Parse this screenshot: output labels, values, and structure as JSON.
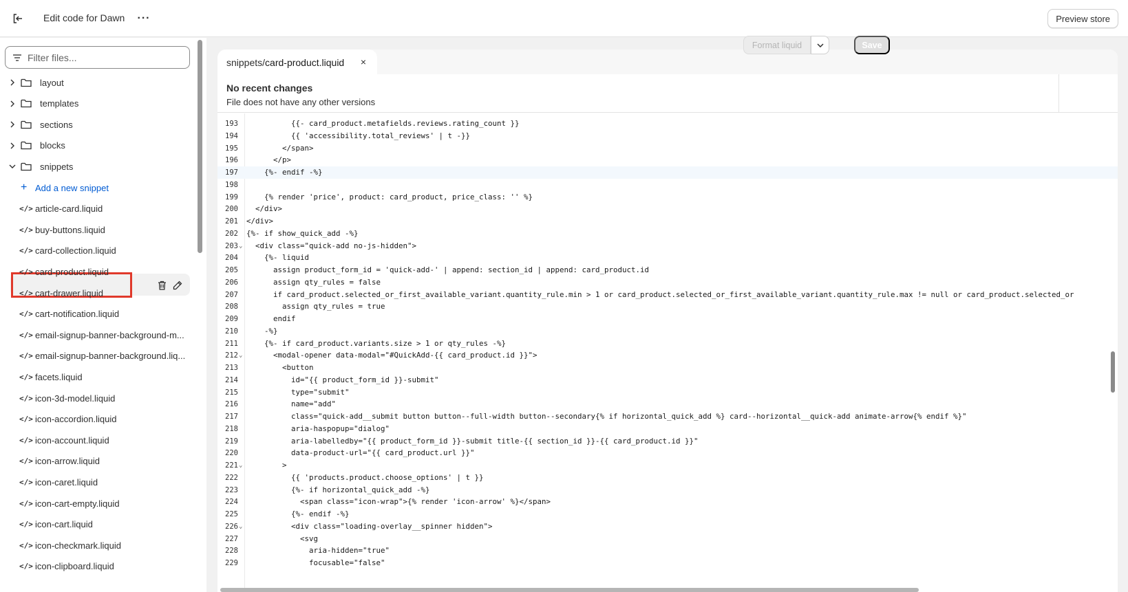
{
  "topbar": {
    "title": "Edit code for Dawn",
    "more": "···",
    "preview_label": "Preview store"
  },
  "sidebar": {
    "filter_placeholder": "Filter files...",
    "folders": [
      {
        "label": "layout",
        "expanded": false
      },
      {
        "label": "templates",
        "expanded": false
      },
      {
        "label": "sections",
        "expanded": false
      },
      {
        "label": "blocks",
        "expanded": false
      },
      {
        "label": "snippets",
        "expanded": true
      }
    ],
    "add_snippet_label": "Add a new snippet",
    "files": [
      "article-card.liquid",
      "buy-buttons.liquid",
      "card-collection.liquid",
      "card-product.liquid",
      "cart-drawer.liquid",
      "cart-notification.liquid",
      "email-signup-banner-background-m...",
      "email-signup-banner-background.liq...",
      "facets.liquid",
      "icon-3d-model.liquid",
      "icon-accordion.liquid",
      "icon-account.liquid",
      "icon-arrow.liquid",
      "icon-caret.liquid",
      "icon-cart-empty.liquid",
      "icon-cart.liquid",
      "icon-checkmark.liquid",
      "icon-clipboard.liquid"
    ],
    "selected_file": "card-product.liquid"
  },
  "editor": {
    "tab": {
      "dir": "snippets/",
      "name": "card-product.liquid",
      "close": "×"
    },
    "info_title": "No recent changes",
    "info_sub": "File does not have any other versions",
    "format_label": "Format liquid",
    "save_label": "Save",
    "current_line": 197,
    "lines": [
      {
        "n": 193,
        "text": "          {{- card_product.metafields.reviews.rating_count }}"
      },
      {
        "n": 194,
        "text": "          {{ 'accessibility.total_reviews' | t -}}"
      },
      {
        "n": 195,
        "text": "        </span>"
      },
      {
        "n": 196,
        "text": "      </p>"
      },
      {
        "n": 197,
        "text": "    {%- endif -%}"
      },
      {
        "n": 198,
        "text": ""
      },
      {
        "n": 199,
        "text": "    {% render 'price', product: card_product, price_class: '' %}"
      },
      {
        "n": 200,
        "text": "  </div>"
      },
      {
        "n": 201,
        "text": "</div>"
      },
      {
        "n": 202,
        "text": "{%- if show_quick_add -%}"
      },
      {
        "n": 203,
        "text": "  <div class=\"quick-add no-js-hidden\">",
        "fold": true
      },
      {
        "n": 204,
        "text": "    {%- liquid"
      },
      {
        "n": 205,
        "text": "      assign product_form_id = 'quick-add-' | append: section_id | append: card_product.id"
      },
      {
        "n": 206,
        "text": "      assign qty_rules = false"
      },
      {
        "n": 207,
        "text": "      if card_product.selected_or_first_available_variant.quantity_rule.min > 1 or card_product.selected_or_first_available_variant.quantity_rule.max != null or card_product.selected_or"
      },
      {
        "n": 208,
        "text": "        assign qty_rules = true"
      },
      {
        "n": 209,
        "text": "      endif"
      },
      {
        "n": 210,
        "text": "    -%}"
      },
      {
        "n": 211,
        "text": "    {%- if card_product.variants.size > 1 or qty_rules -%}"
      },
      {
        "n": 212,
        "text": "      <modal-opener data-modal=\"#QuickAdd-{{ card_product.id }}\">",
        "fold": true
      },
      {
        "n": 213,
        "text": "        <button"
      },
      {
        "n": 214,
        "text": "          id=\"{{ product_form_id }}-submit\""
      },
      {
        "n": 215,
        "text": "          type=\"submit\""
      },
      {
        "n": 216,
        "text": "          name=\"add\""
      },
      {
        "n": 217,
        "text": "          class=\"quick-add__submit button button--full-width button--secondary{% if horizontal_quick_add %} card--horizontal__quick-add animate-arrow{% endif %}\""
      },
      {
        "n": 218,
        "text": "          aria-haspopup=\"dialog\""
      },
      {
        "n": 219,
        "text": "          aria-labelledby=\"{{ product_form_id }}-submit title-{{ section_id }}-{{ card_product.id }}\""
      },
      {
        "n": 220,
        "text": "          data-product-url=\"{{ card_product.url }}\""
      },
      {
        "n": 221,
        "text": "        >",
        "fold": true
      },
      {
        "n": 222,
        "text": "          {{ 'products.product.choose_options' | t }}"
      },
      {
        "n": 223,
        "text": "          {%- if horizontal_quick_add -%}"
      },
      {
        "n": 224,
        "text": "            <span class=\"icon-wrap\">{% render 'icon-arrow' %}</span>"
      },
      {
        "n": 225,
        "text": "          {%- endif -%}"
      },
      {
        "n": 226,
        "text": "          <div class=\"loading-overlay__spinner hidden\">",
        "fold": true
      },
      {
        "n": 227,
        "text": "            <svg"
      },
      {
        "n": 228,
        "text": "              aria-hidden=\"true\""
      },
      {
        "n": 229,
        "text": "              focusable=\"false\""
      }
    ]
  }
}
